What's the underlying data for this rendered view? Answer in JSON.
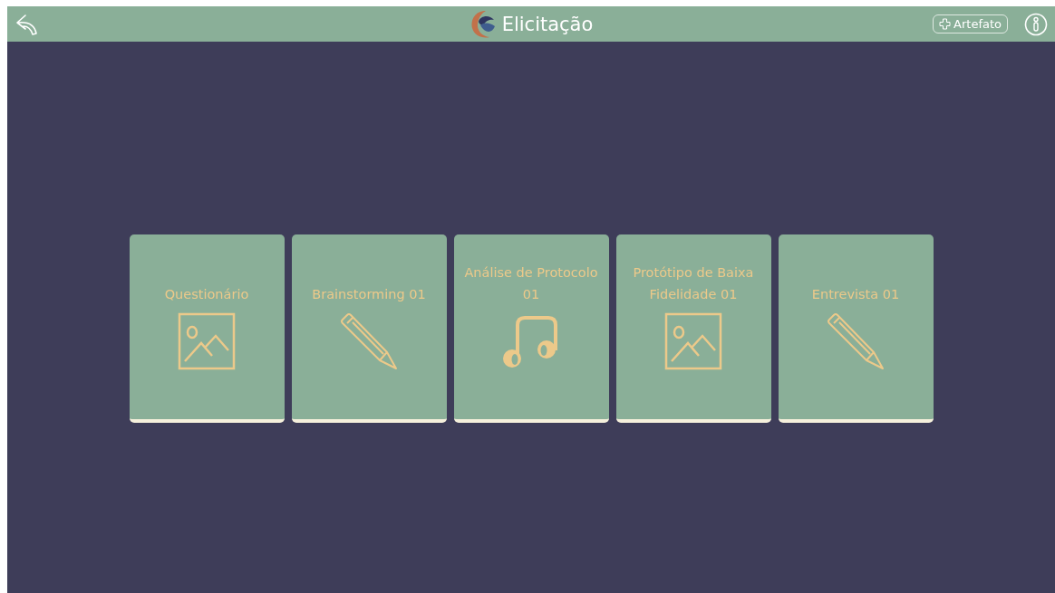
{
  "header": {
    "title": "Elicitação",
    "add_button": "Artefato"
  },
  "cards": [
    {
      "title": "Questionário",
      "kind": "image"
    },
    {
      "title": "Brainstorming 01",
      "kind": "pencil"
    },
    {
      "title": "Análise de Protocolo 01",
      "kind": "music"
    },
    {
      "title": "Protótipo de Baixa Fidelidade 01",
      "kind": "image"
    },
    {
      "title": "Entrevista 01",
      "kind": "pencil"
    }
  ]
}
